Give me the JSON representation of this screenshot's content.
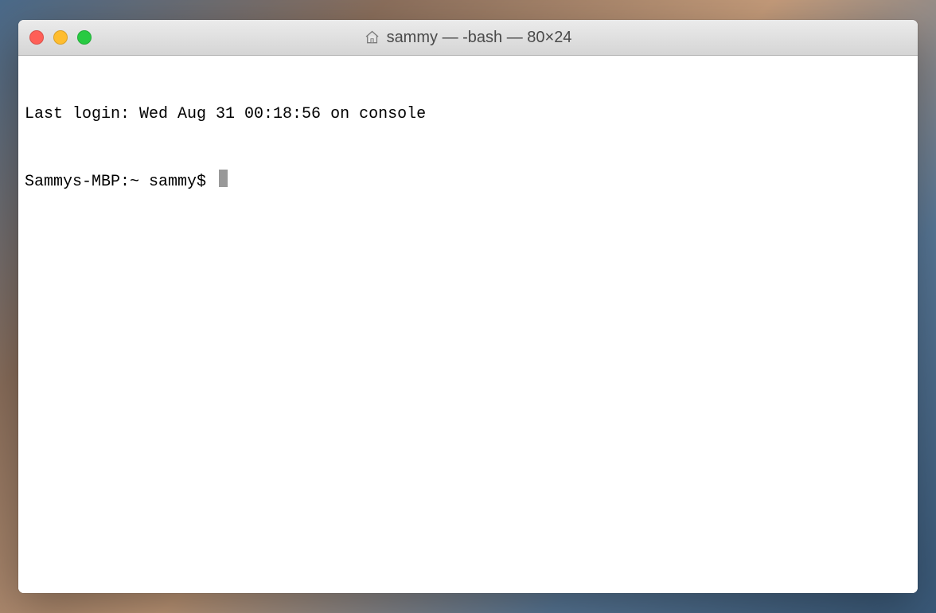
{
  "window": {
    "title": "sammy — -bash — 80×24"
  },
  "terminal": {
    "last_login_line": "Last login: Wed Aug 31 00:18:56 on console",
    "prompt": "Sammys-MBP:~ sammy$ "
  }
}
